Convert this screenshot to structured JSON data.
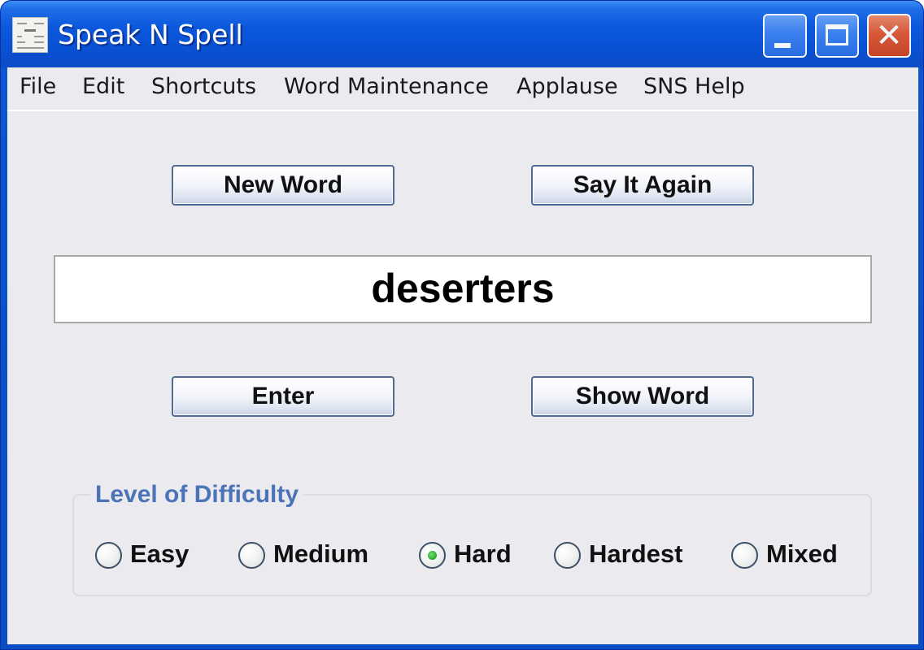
{
  "window": {
    "title": "Speak N Spell",
    "controls": {
      "minimize_icon": "minimize-icon",
      "maximize_icon": "maximize-icon",
      "close_glyph": "✕"
    }
  },
  "menubar": {
    "items": [
      {
        "label": "File"
      },
      {
        "label": "Edit"
      },
      {
        "label": "Shortcuts"
      },
      {
        "label": "Word Maintenance"
      },
      {
        "label": "Applause"
      },
      {
        "label": "SNS Help"
      }
    ]
  },
  "buttons": {
    "new_word": "New Word",
    "say_it_again": "Say It Again",
    "enter": "Enter",
    "show_word": "Show Word"
  },
  "word_field": {
    "value": "deserters"
  },
  "difficulty": {
    "legend": "Level of Difficulty",
    "options": [
      {
        "label": "Easy",
        "selected": false
      },
      {
        "label": "Medium",
        "selected": false
      },
      {
        "label": "Hard",
        "selected": true
      },
      {
        "label": "Hardest",
        "selected": false
      },
      {
        "label": "Mixed",
        "selected": false
      }
    ],
    "selected": "Hard",
    "accent_color": "#4b73b7",
    "selected_dot_color": "#2aa52a"
  }
}
